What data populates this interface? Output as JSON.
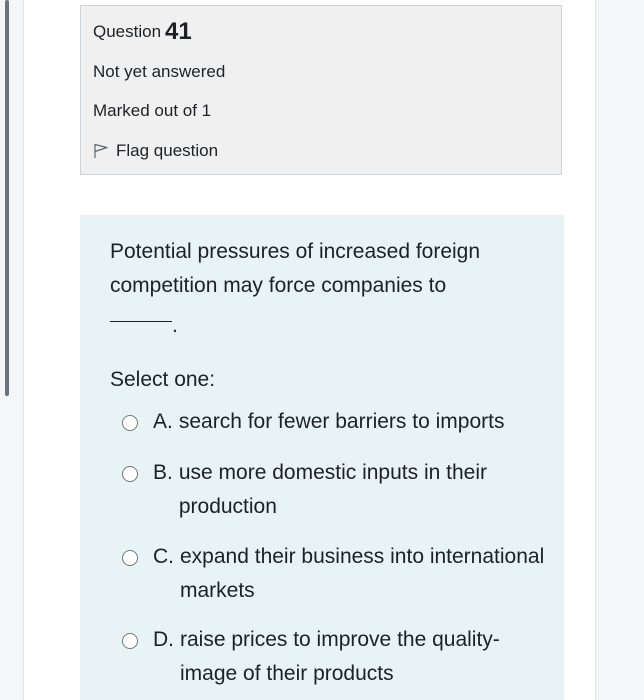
{
  "question_info": {
    "title_prefix": "Question",
    "number": "41",
    "state": "Not yet answered",
    "grade": "Marked out of 1",
    "flag_label": "Flag question",
    "flag_icon": "flag-outline-icon"
  },
  "form": {
    "question_text": "Potential pressures of increased foreign competition may force companies to",
    "blank_suffix": ".",
    "prompt": "Select one:",
    "answers": [
      {
        "letter": "A.",
        "text": "search for fewer barriers to imports"
      },
      {
        "letter": "B.",
        "text": "use more domestic inputs in their production"
      },
      {
        "letter": "C.",
        "text": "expand their business into international markets"
      },
      {
        "letter": "D.",
        "text": "raise prices to improve the quality-image of their products"
      }
    ]
  },
  "colors": {
    "info_bg": "#f0f0f0",
    "form_bg": "#e7f3f5",
    "text": "#1d2125",
    "page_bg": "#f4f6f8"
  }
}
